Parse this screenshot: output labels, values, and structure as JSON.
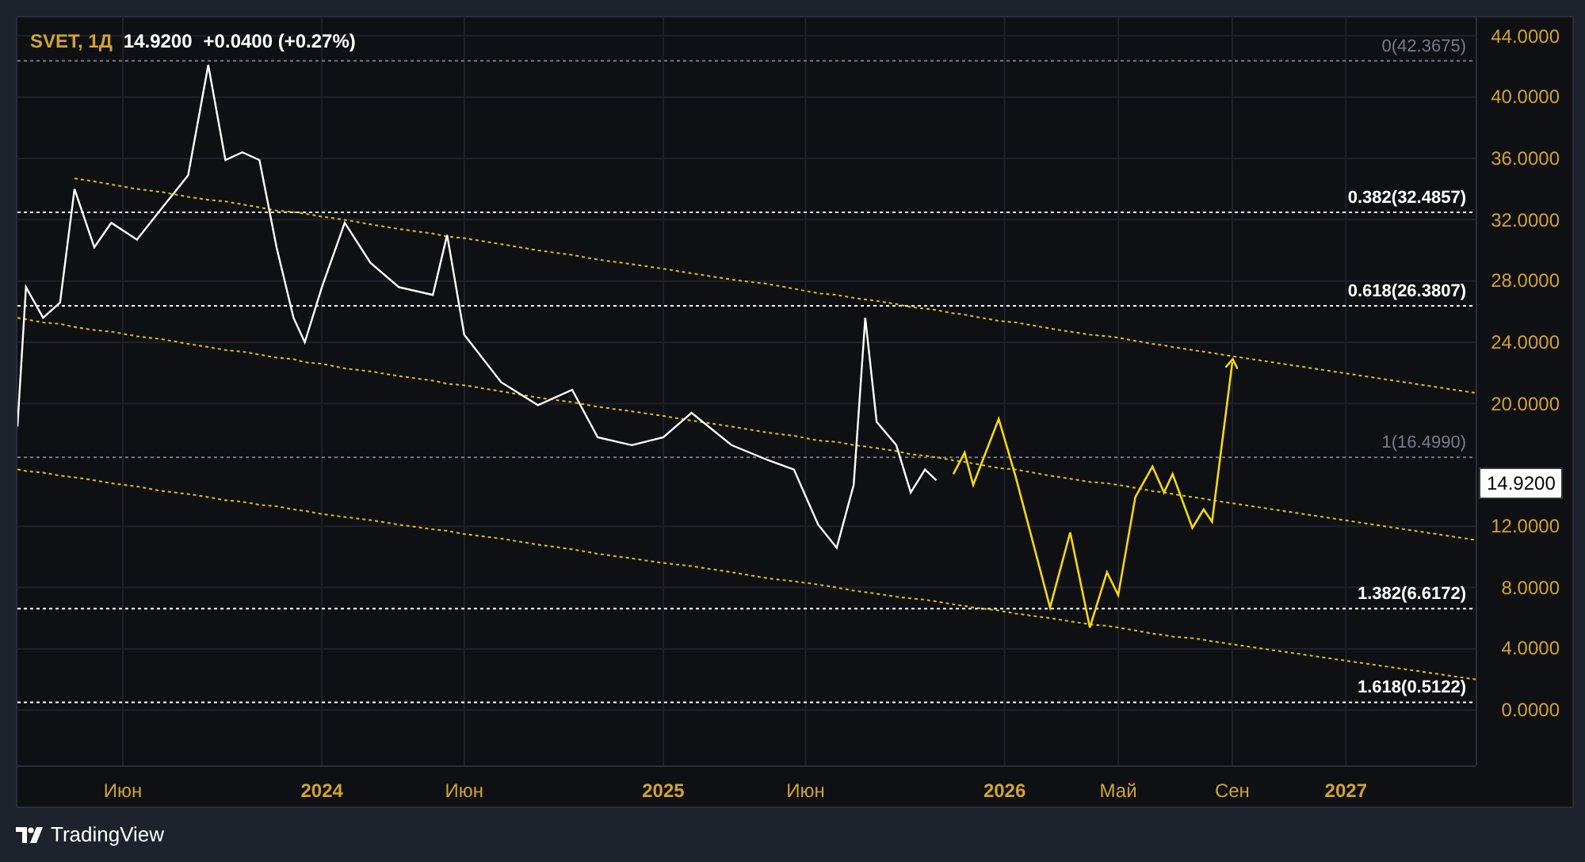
{
  "legend": {
    "symbol": "SVET, 1Д",
    "price": "14.9200",
    "change": "+0.0400 (+0.27%)"
  },
  "price_badge": "14.9200",
  "chart": {
    "chart_data": {
      "type": "line",
      "x": [
        2023.108,
        2023.133,
        2023.183,
        2023.233,
        2023.275,
        2023.333,
        2023.383,
        2023.458,
        2023.533,
        2023.608,
        2023.667,
        2023.717,
        2023.767,
        2023.817,
        2023.867,
        2023.917,
        2023.95,
        2024.0,
        2024.067,
        2024.142,
        2024.225,
        2024.325,
        2024.367,
        2024.417,
        2024.525,
        2024.633,
        2024.733,
        2024.808,
        2024.908,
        2025.0,
        2025.083,
        2025.2,
        2025.308,
        2025.383,
        2025.454,
        2025.508,
        2025.558,
        2025.592,
        2025.625,
        2025.683,
        2025.725,
        2025.767,
        2025.8,
        2025.85,
        2025.883,
        2025.908,
        2025.983,
        2026.033,
        2026.133,
        2026.192,
        2026.25,
        2026.3,
        2026.333,
        2026.383,
        2026.433,
        2026.467,
        2026.492,
        2026.55,
        2026.583,
        2026.608,
        2026.667,
        2027.38
      ],
      "series": [
        {
          "color": "#ffffff",
          "line_style": "solid",
          "values": [
            18.5,
            27.6,
            25.6,
            26.6,
            34,
            30.2,
            31.8,
            30.7,
            32.8,
            34.9,
            42.1,
            35.9,
            36.4,
            35.9,
            30.2,
            25.6,
            24,
            27.6,
            31.8,
            29.2,
            27.6,
            27.1,
            31,
            24.5,
            21.4,
            19.9,
            20.9,
            17.8,
            17.3,
            17.8,
            19.4,
            17.3,
            16.3,
            15.7,
            12.1,
            10.6,
            14.7,
            25.6,
            18.8,
            17.3,
            14.2,
            15.7,
            15,
            null,
            null,
            null,
            null,
            null,
            null,
            null,
            null,
            null,
            null,
            null,
            null,
            null,
            null,
            null,
            null,
            null,
            null,
            null
          ]
        },
        {
          "color": "#f5d90a",
          "line_style": "solid",
          "values": [
            null,
            null,
            null,
            null,
            null,
            null,
            null,
            null,
            null,
            null,
            null,
            null,
            null,
            null,
            null,
            null,
            null,
            null,
            null,
            null,
            null,
            null,
            null,
            null,
            null,
            null,
            null,
            null,
            null,
            null,
            null,
            null,
            null,
            null,
            null,
            null,
            null,
            null,
            null,
            null,
            null,
            null,
            null,
            15.4,
            16.8,
            14.7,
            19,
            15.2,
            6.7,
            11.6,
            5.4,
            9,
            7.5,
            13.9,
            15.9,
            14.2,
            15.4,
            11.9,
            13.1,
            12.3,
            22.7,
            null
          ]
        },
        {
          "color": "#d6c21a",
          "line_style": "dotted",
          "values": [
            null,
            null,
            null,
            null,
            34.7,
            34.5,
            34.3,
            34.0,
            33.8,
            33.5,
            33.3,
            33.2,
            33.0,
            32.8,
            32.6,
            32.5,
            32.4,
            32.2,
            32.0,
            31.7,
            31.4,
            31.1,
            30.9,
            30.8,
            30.4,
            30.0,
            29.7,
            29.4,
            29.1,
            28.8,
            28.5,
            28.1,
            27.8,
            27.5,
            27.2,
            27.1,
            26.9,
            26.8,
            26.7,
            26.5,
            26.3,
            26.2,
            26.1,
            25.9,
            25.8,
            25.7,
            25.4,
            25.3,
            24.9,
            24.7,
            24.5,
            24.4,
            24.3,
            24.1,
            23.9,
            23.8,
            23.7,
            23.5,
            23.4,
            23.3,
            23.1,
            20.7
          ]
        },
        {
          "color": "#d6c21a",
          "line_style": "dotted",
          "values": [
            25.6,
            25.5,
            25.3,
            25.2,
            25.0,
            24.8,
            24.7,
            24.4,
            24.2,
            23.9,
            23.7,
            23.5,
            23.4,
            23.2,
            23.0,
            22.9,
            22.7,
            22.6,
            22.3,
            22.1,
            21.8,
            21.5,
            21.3,
            21.2,
            20.8,
            20.4,
            20.1,
            19.8,
            19.5,
            19.2,
            18.9,
            18.5,
            18.1,
            17.9,
            17.6,
            17.5,
            17.3,
            17.2,
            17.1,
            16.9,
            16.7,
            16.6,
            16.5,
            16.3,
            16.2,
            16.1,
            15.8,
            15.7,
            15.3,
            15.1,
            14.9,
            14.8,
            14.7,
            14.5,
            14.3,
            14.2,
            14.1,
            13.9,
            13.8,
            13.7,
            13.5,
            11.1
          ]
        },
        {
          "color": "#d6c21a",
          "line_style": "dotted",
          "values": [
            15.7,
            15.6,
            15.5,
            15.3,
            15.2,
            15.0,
            14.8,
            14.6,
            14.3,
            14.1,
            13.9,
            13.7,
            13.6,
            13.4,
            13.3,
            13.1,
            13.0,
            12.8,
            12.6,
            12.4,
            12.1,
            11.8,
            11.7,
            11.5,
            11.2,
            10.8,
            10.5,
            10.2,
            9.9,
            9.6,
            9.4,
            9.0,
            8.6,
            8.4,
            8.2,
            8.0,
            7.8,
            7.7,
            7.6,
            7.4,
            7.3,
            7.2,
            7.1,
            6.9,
            6.8,
            6.7,
            6.5,
            6.3,
            6.0,
            5.8,
            5.6,
            5.5,
            5.4,
            5.2,
            5.0,
            4.9,
            4.8,
            4.7,
            4.6,
            4.5,
            4.3,
            2.0
          ]
        }
      ],
      "xlim": [
        2023.108,
        2027.38
      ],
      "ylim": [
        -3.6,
        45.2
      ],
      "grid": true,
      "xticks": [
        {
          "value": 2023.417,
          "label": "Июн"
        },
        {
          "value": 2024,
          "label": "2024"
        },
        {
          "value": 2024.417,
          "label": "Июн"
        },
        {
          "value": 2025,
          "label": "2025"
        },
        {
          "value": 2025.417,
          "label": "Июн"
        },
        {
          "value": 2026,
          "label": "2026"
        },
        {
          "value": 2026.333,
          "label": "Май"
        },
        {
          "value": 2026.667,
          "label": "Сен"
        },
        {
          "value": 2027,
          "label": "2027"
        }
      ],
      "yticks": [
        {
          "value": 44,
          "label": "44.0000"
        },
        {
          "value": 40,
          "label": "40.0000"
        },
        {
          "value": 36,
          "label": "36.0000"
        },
        {
          "value": 32,
          "label": "32.0000"
        },
        {
          "value": 28,
          "label": "28.0000"
        },
        {
          "value": 24,
          "label": "24.0000"
        },
        {
          "value": 20,
          "label": "20.0000"
        },
        {
          "value": 12,
          "label": "12.0000"
        },
        {
          "value": 8,
          "label": "8.0000"
        },
        {
          "value": 4,
          "label": "4.0000"
        },
        {
          "value": 0,
          "label": "0.0000"
        }
      ],
      "ref_lines": [
        {
          "axis": "y",
          "value": 42.3675,
          "label": "0(42.3675)",
          "color": "#787b86"
        },
        {
          "axis": "y",
          "value": 32.4857,
          "label": "0.382(32.4857)",
          "color": "#ffffff"
        },
        {
          "axis": "y",
          "value": 26.3807,
          "label": "0.618(26.3807)",
          "color": "#ffffff"
        },
        {
          "axis": "y",
          "value": 16.499,
          "label": "1(16.4990)",
          "color": "#787b86"
        },
        {
          "axis": "y",
          "value": 6.6172,
          "label": "1.382(6.6172)",
          "color": "#ffffff"
        },
        {
          "axis": "y",
          "value": 0.5122,
          "label": "1.618(0.5122)",
          "color": "#ffffff"
        }
      ]
    }
  },
  "brand": "TradingView"
}
